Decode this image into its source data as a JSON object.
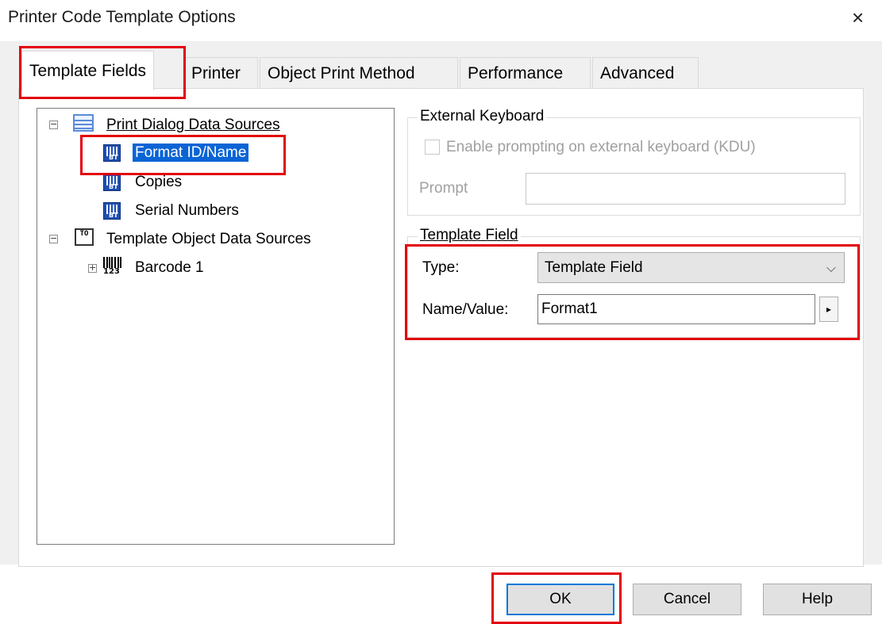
{
  "window": {
    "title": "Printer Code Template Options",
    "close_glyph": "×"
  },
  "tabs": [
    {
      "label": "Template Fields",
      "selected": true
    },
    {
      "label": "Printer"
    },
    {
      "label": "Object Print Method"
    },
    {
      "label": "Performance"
    },
    {
      "label": "Advanced"
    }
  ],
  "tree": {
    "print_dialog": {
      "label": "Print Dialog Data Sources",
      "expander": "−",
      "children": [
        "Format ID/Name",
        "Copies",
        "Serial Numbers"
      ]
    },
    "template_object": {
      "label": "Template Object Data Sources",
      "expander": "−",
      "icon_text": "TO",
      "children": [
        {
          "label": "Barcode 1",
          "expander": "+"
        }
      ]
    },
    "selected": "Format ID/Name"
  },
  "external_keyboard": {
    "group_title": "External Keyboard",
    "checkbox_label": "Enable prompting on external keyboard (KDU)",
    "checked": false,
    "prompt_label": "Prompt",
    "prompt_value": ""
  },
  "template_field": {
    "group_title": "Template Field",
    "type_label": "Type:",
    "type_value": "Template Field",
    "name_label": "Name/Value:",
    "name_value": "Format1",
    "arrow_glyph": "▸"
  },
  "buttons": {
    "ok": "OK",
    "cancel": "Cancel",
    "help": "Help"
  },
  "colors": {
    "highlight": "#e3000b",
    "selection": "#0a64d6",
    "focus": "#0078d7"
  }
}
